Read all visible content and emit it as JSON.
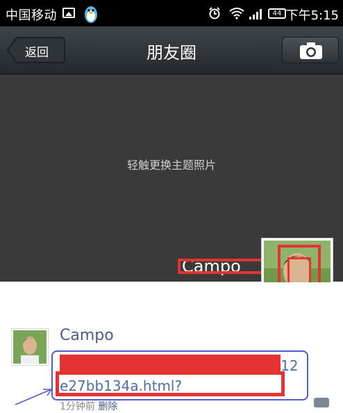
{
  "status_bar": {
    "carrier": "中国移动",
    "battery": "44",
    "time": "下午5:15"
  },
  "nav": {
    "back_label": "返回",
    "title": "朋友圈"
  },
  "cover": {
    "hint": "轻触更换主题照片",
    "user_name": "Campo"
  },
  "post": {
    "author": "Campo",
    "link_text": "http://y.qq.com/…/7ff0bfc69b7412e27bb134a.html?",
    "link_line_visible": "7ff0bfc69b7412e27bb134a.html?",
    "time": "1分钟前",
    "delete": "删除"
  },
  "colors": {
    "nav_bg": "#2c3034",
    "link": "#4d6fa8",
    "name": "#4a5d8a",
    "redaction": "#e53232",
    "annotation": "#4d5bcf"
  }
}
